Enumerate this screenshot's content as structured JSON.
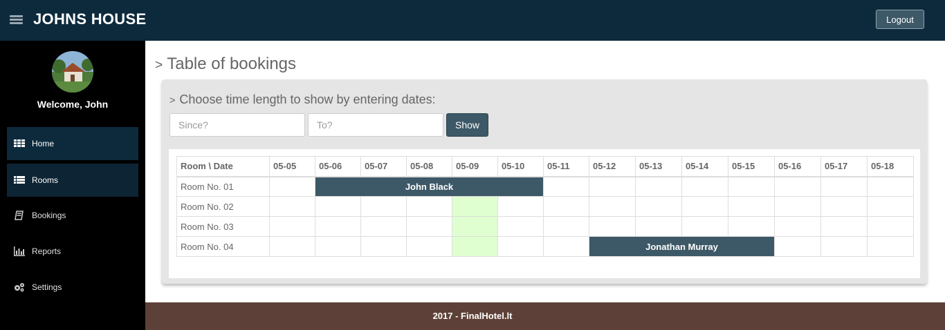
{
  "app": {
    "title": "JOHNS HOUSE",
    "logout_label": "Logout"
  },
  "sidebar": {
    "welcome": "Welcome, John",
    "items": [
      {
        "label": "Home",
        "icon": "grid-icon"
      },
      {
        "label": "Rooms",
        "icon": "list-icon"
      },
      {
        "label": "Bookings",
        "icon": "book-icon"
      },
      {
        "label": "Reports",
        "icon": "bar-chart-icon"
      },
      {
        "label": "Settings",
        "icon": "gears-icon"
      }
    ]
  },
  "main": {
    "title": "Table of bookings",
    "filter": {
      "title": "Choose time length to show by entering dates:",
      "since_placeholder": "Since?",
      "to_placeholder": "To?",
      "show_label": "Show"
    },
    "table": {
      "corner_header": "Room \\ Date",
      "dates": [
        "05-05",
        "05-06",
        "05-07",
        "05-08",
        "05-09",
        "05-10",
        "05-11",
        "05-12",
        "05-13",
        "05-14",
        "05-15",
        "05-16",
        "05-17",
        "05-18"
      ],
      "today": "05-09",
      "rooms": [
        "Room No. 01",
        "Room No. 02",
        "Room No. 03",
        "Room No. 04"
      ],
      "bookings": [
        {
          "room": "Room No. 01",
          "guest": "John Black",
          "from": "05-06",
          "to": "05-10"
        },
        {
          "room": "Room No. 04",
          "guest": "Jonathan Murray",
          "from": "05-12",
          "to": "05-15"
        }
      ]
    }
  },
  "footer": {
    "text": "2017 - FinalHotel.lt"
  },
  "colors": {
    "topbar": "#0d2a3d",
    "sidebar": "#000000",
    "accent": "#3d5866",
    "today": "#e0ffd0",
    "footer": "#5d4037"
  }
}
